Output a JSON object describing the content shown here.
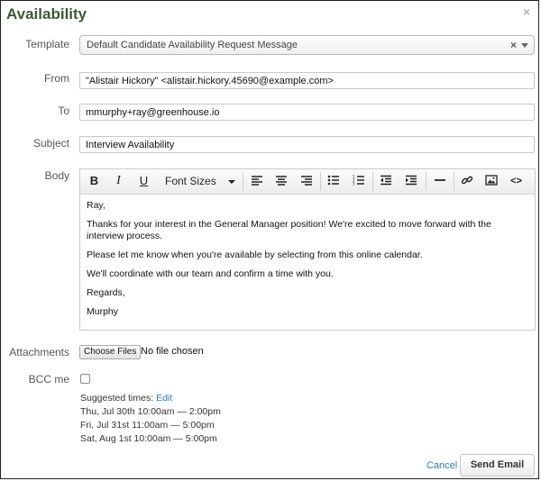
{
  "dialog": {
    "title": "Availability",
    "close_glyph": "×"
  },
  "form": {
    "template": {
      "label": "Template",
      "value": "Default Candidate Availability Request Message",
      "clear_glyph": "×"
    },
    "from": {
      "label": "From",
      "value": "\"Alistair Hickory\" <alistair.hickory.45690@example.com>"
    },
    "to": {
      "label": "To",
      "value": "mmurphy+ray@greenhouse.io"
    },
    "subject": {
      "label": "Subject",
      "value": "Interview Availability"
    },
    "body": {
      "label": "Body",
      "toolbar": {
        "bold": "B",
        "italic": "I",
        "underline": "U",
        "font_sizes": "Font Sizes",
        "code": "<>"
      },
      "paragraphs": [
        "Ray,",
        "Thanks for your interest in the General Manager position! We're excited to move forward with the interview process.",
        "Please let me know when you're available by selecting from this online calendar.",
        "We'll coordinate with our team and confirm a time with you.",
        "Regards,",
        "Murphy"
      ]
    },
    "attachments": {
      "label": "Attachments",
      "button": "Choose Files",
      "status": "No file chosen"
    },
    "bcc": {
      "label": "BCC me"
    }
  },
  "suggested": {
    "label": "Suggested times:",
    "edit": "Edit",
    "times": [
      "Thu, Jul 30th 10:00am — 2:00pm",
      "Fri, Jul 31st 11:00am — 5:00pm",
      "Sat, Aug 1st 10:00am — 5:00pm"
    ]
  },
  "actions": {
    "cancel": "Cancel",
    "send": "Send Email"
  },
  "colors": {
    "title": "#3d5a33",
    "link": "#2a7ab8"
  }
}
